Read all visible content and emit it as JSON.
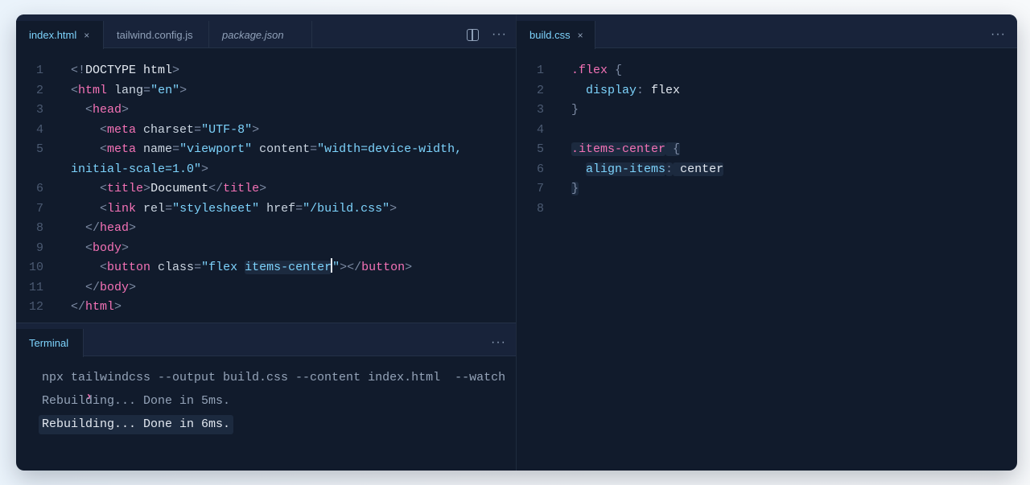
{
  "left_tabs": [
    {
      "label": "index.html",
      "active": true,
      "closable": true,
      "italic": false
    },
    {
      "label": "tailwind.config.js",
      "active": false,
      "closable": false,
      "italic": false
    },
    {
      "label": "package.json",
      "active": false,
      "closable": false,
      "italic": true
    }
  ],
  "right_tabs": [
    {
      "label": "build.css",
      "active": true,
      "closable": true
    }
  ],
  "close_glyph": "×",
  "more_glyph": "···",
  "icons": {
    "split": "split-editor-icon",
    "more": "more-options-icon",
    "prompt": "chevron-right-icon"
  },
  "html_editor": {
    "lines": [
      {
        "num": "1",
        "tokens": [
          [
            "p",
            "<!"
          ],
          [
            "t",
            "DOCTYPE html"
          ],
          [
            "p",
            ">"
          ]
        ]
      },
      {
        "num": "2",
        "tokens": [
          [
            "p",
            "<"
          ],
          [
            "g",
            "html"
          ],
          [
            "a",
            " lang"
          ],
          [
            "p",
            "="
          ],
          [
            "s",
            "\"en\""
          ],
          [
            "p",
            ">"
          ]
        ]
      },
      {
        "num": "3",
        "tokens": [
          [
            "t",
            "  "
          ],
          [
            "p",
            "<"
          ],
          [
            "g",
            "head"
          ],
          [
            "p",
            ">"
          ]
        ]
      },
      {
        "num": "4",
        "tokens": [
          [
            "t",
            "    "
          ],
          [
            "p",
            "<"
          ],
          [
            "g",
            "meta"
          ],
          [
            "a",
            " charset"
          ],
          [
            "p",
            "="
          ],
          [
            "s",
            "\"UTF-8\""
          ],
          [
            "p",
            ">"
          ]
        ]
      },
      {
        "num": "5",
        "tokens": [
          [
            "t",
            "    "
          ],
          [
            "p",
            "<"
          ],
          [
            "g",
            "meta"
          ],
          [
            "a",
            " name"
          ],
          [
            "p",
            "="
          ],
          [
            "s",
            "\"viewport\""
          ],
          [
            "a",
            " content"
          ],
          [
            "p",
            "="
          ],
          [
            "s",
            "\"width=device-width,"
          ]
        ]
      },
      {
        "num": "",
        "tokens": [
          [
            "s",
            "initial-scale=1.0\""
          ],
          [
            "p",
            ">"
          ]
        ]
      },
      {
        "num": "6",
        "tokens": [
          [
            "t",
            "    "
          ],
          [
            "p",
            "<"
          ],
          [
            "g",
            "title"
          ],
          [
            "p",
            ">"
          ],
          [
            "t",
            "Document"
          ],
          [
            "p",
            "</"
          ],
          [
            "g",
            "title"
          ],
          [
            "p",
            ">"
          ]
        ]
      },
      {
        "num": "7",
        "tokens": [
          [
            "t",
            "    "
          ],
          [
            "p",
            "<"
          ],
          [
            "g",
            "link"
          ],
          [
            "a",
            " rel"
          ],
          [
            "p",
            "="
          ],
          [
            "s",
            "\"stylesheet\""
          ],
          [
            "a",
            " href"
          ],
          [
            "p",
            "="
          ],
          [
            "s",
            "\"/build.css\""
          ],
          [
            "p",
            ">"
          ]
        ]
      },
      {
        "num": "8",
        "tokens": [
          [
            "t",
            "  "
          ],
          [
            "p",
            "</"
          ],
          [
            "g",
            "head"
          ],
          [
            "p",
            ">"
          ]
        ]
      },
      {
        "num": "9",
        "tokens": [
          [
            "t",
            "  "
          ],
          [
            "p",
            "<"
          ],
          [
            "g",
            "body"
          ],
          [
            "p",
            ">"
          ]
        ]
      },
      {
        "num": "10",
        "tokens": [
          [
            "t",
            "    "
          ],
          [
            "p",
            "<"
          ],
          [
            "g",
            "button"
          ],
          [
            "a",
            " class"
          ],
          [
            "p",
            "="
          ],
          [
            "s",
            "\"flex "
          ],
          [
            "sh",
            "items-center"
          ],
          [
            "c",
            ""
          ],
          [
            "s",
            "\""
          ],
          [
            "p",
            "></"
          ],
          [
            "g",
            "button"
          ],
          [
            "p",
            ">"
          ]
        ]
      },
      {
        "num": "11",
        "tokens": [
          [
            "t",
            "  "
          ],
          [
            "p",
            "</"
          ],
          [
            "g",
            "body"
          ],
          [
            "p",
            ">"
          ]
        ]
      },
      {
        "num": "12",
        "tokens": [
          [
            "p",
            "</"
          ],
          [
            "g",
            "html"
          ],
          [
            "p",
            ">"
          ]
        ]
      }
    ]
  },
  "css_editor": {
    "lines": [
      {
        "num": "1",
        "tokens": [
          [
            "sel",
            ".flex"
          ],
          [
            "p",
            " {"
          ]
        ]
      },
      {
        "num": "2",
        "tokens": [
          [
            "t",
            "  "
          ],
          [
            "prop",
            "display"
          ],
          [
            "p",
            ":"
          ],
          [
            "v",
            " flex"
          ]
        ]
      },
      {
        "num": "3",
        "tokens": [
          [
            "p",
            "}"
          ]
        ]
      },
      {
        "num": "4",
        "tokens": []
      },
      {
        "num": "5",
        "tokens": [
          [
            "selh",
            ".items-center"
          ],
          [
            "ph",
            " {"
          ]
        ]
      },
      {
        "num": "6",
        "tokens": [
          [
            "t",
            "  "
          ],
          [
            "proph",
            "align-items"
          ],
          [
            "ph",
            ":"
          ],
          [
            "vh",
            " center"
          ]
        ]
      },
      {
        "num": "7",
        "tokens": [
          [
            "ph",
            "}"
          ]
        ]
      },
      {
        "num": "8",
        "tokens": []
      }
    ]
  },
  "terminal": {
    "tab_label": "Terminal",
    "prompt": "›",
    "command": "npx tailwindcss --output build.css --content index.html  --watch",
    "output": [
      {
        "text": "Rebuilding... Done in 5ms.",
        "highlight": false
      },
      {
        "text": "Rebuilding... Done in 6ms.",
        "highlight": true
      }
    ]
  },
  "colors": {
    "window_bg": "#111b2c",
    "tabbar_bg": "#18233a",
    "tag": "#f472b6",
    "string": "#7dd3fc",
    "text": "#e2e8f0",
    "line_number": "#4b5a72"
  }
}
